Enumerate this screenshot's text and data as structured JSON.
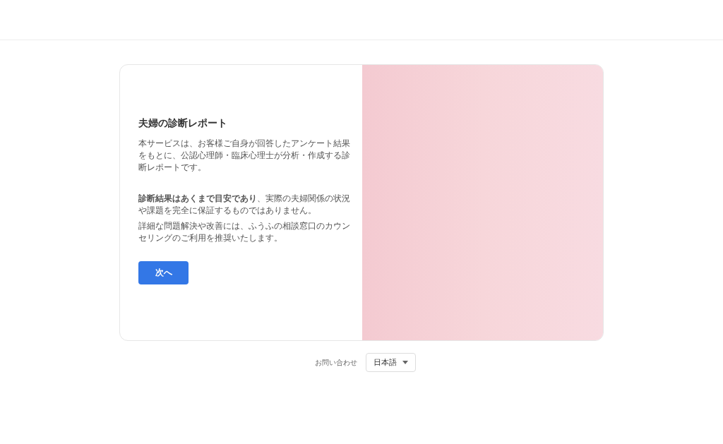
{
  "card": {
    "title": "夫婦の診断レポート",
    "paragraphs": [
      "本サービスは、お客様ご自身が回答したアンケート結果をもとに、公認心理師・臨床心理士が分析・作成する診断レポートです。",
      "**診断結果はあくまで目安であり**、実際の夫婦関係の状況や課題を完全に保証するものではありません。",
      "詳細な問題解決や改善には、ふうふの相談窓口のカウンセリングのご利用を推奨いたします。"
    ],
    "button": "次へ"
  },
  "footer": {
    "contact_link": "お問い合わせ",
    "language_select": {
      "value": "日本語"
    }
  }
}
